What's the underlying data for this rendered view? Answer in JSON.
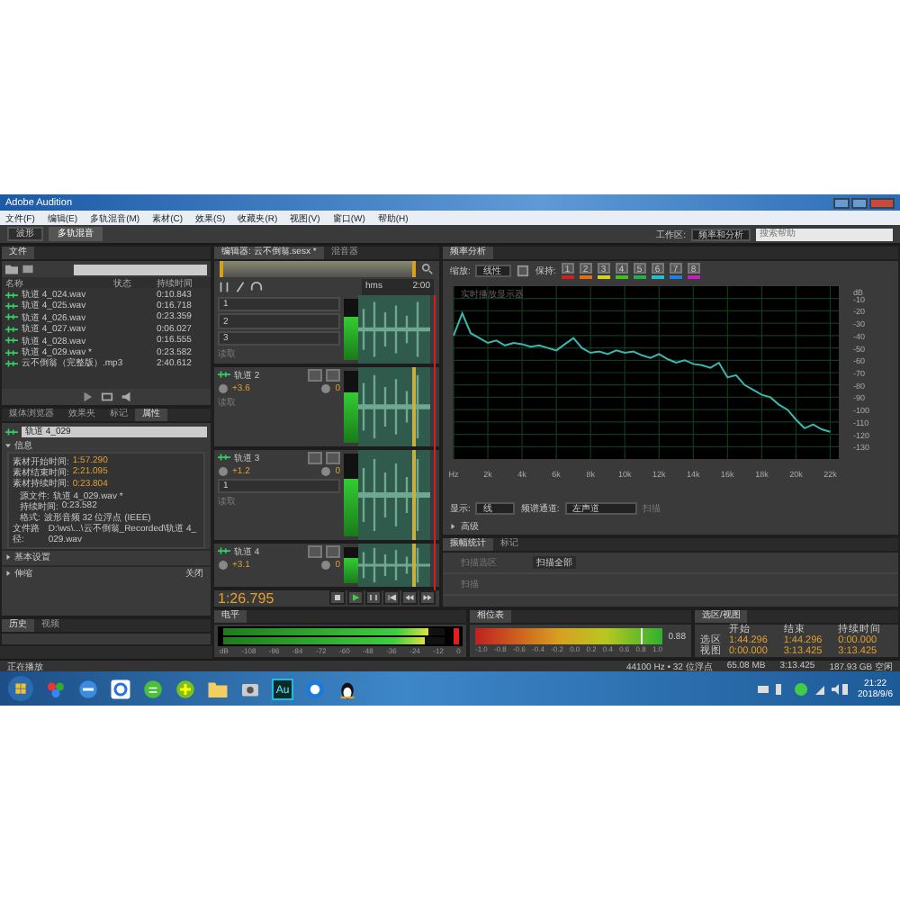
{
  "title_bar": {
    "title": "Adobe Audition"
  },
  "menu": [
    "文件(F)",
    "编辑(E)",
    "多轨混音(M)",
    "素材(C)",
    "效果(S)",
    "收藏夹(R)",
    "视图(V)",
    "窗口(W)",
    "帮助(H)"
  ],
  "toolbar": {
    "modes": [
      {
        "label": "波形",
        "selected": false
      },
      {
        "label": "多轨混音",
        "selected": true
      }
    ],
    "workspace_label": "工作区:",
    "workspace": "频率和分析",
    "search": {
      "placeholder": "搜索帮助"
    }
  },
  "files_panel": {
    "tab": "文件",
    "columns": [
      "名称",
      "状态",
      "持续时间"
    ],
    "rows": [
      {
        "name": "轨道 4_024.wav",
        "duration": "0:10.843"
      },
      {
        "name": "轨道 4_025.wav",
        "duration": "0:16.718"
      },
      {
        "name": "轨道 4_026.wav",
        "duration": "0:23.359"
      },
      {
        "name": "轨道 4_027.wav",
        "duration": "0:06.027"
      },
      {
        "name": "轨道 4_028.wav",
        "duration": "0:16.555"
      },
      {
        "name": "轨道 4_029.wav *",
        "duration": "0:23.582"
      },
      {
        "name": "云不倒翁（完整版）.mp3",
        "duration": "2:40.612"
      }
    ]
  },
  "properties_panel": {
    "tabs": [
      {
        "label": "媒体浏览器",
        "selected": false
      },
      {
        "label": "效果夹",
        "selected": false
      },
      {
        "label": "标记",
        "selected": false
      },
      {
        "label": "属性",
        "selected": true
      }
    ],
    "clip_name": "轨道 4_029",
    "section": "信息",
    "times": [
      {
        "label": "素材开始时间:",
        "value": "1:57.290"
      },
      {
        "label": "素材结束时间:",
        "value": "2:21.095"
      },
      {
        "label": "素材持续时间:",
        "value": "0:23.804"
      }
    ],
    "info": [
      {
        "label": "源文件:",
        "value": "轨道 4_029.wav *"
      },
      {
        "label": "持续时间:",
        "value": "0:23.582"
      },
      {
        "label": "格式:",
        "value": "波形音频 32 位浮点 (IEEE)"
      },
      {
        "label": "文件路径:",
        "value": "D:\\ws\\...\\云不倒翁_Recorded\\轨道 4_029.wav"
      }
    ],
    "groups": [
      {
        "label": "基本设置"
      },
      {
        "label": "伸缩",
        "value": "关闭"
      }
    ]
  },
  "history_panel": {
    "tabs": [
      {
        "label": "历史",
        "selected": true
      },
      {
        "label": "视频",
        "selected": false
      }
    ]
  },
  "editor": {
    "tabs": [
      {
        "label": "编辑器: 云不倒翁.sesx *",
        "selected": true
      },
      {
        "label": "混音器",
        "selected": false
      }
    ],
    "ruler": [
      "hms",
      "2:00"
    ],
    "tracks": [
      {
        "inputs": [
          "1",
          "2",
          "3"
        ],
        "automation": "读取"
      },
      {
        "name": "轨道 2",
        "volume": "+3.6",
        "pan": "0",
        "automation": "读取"
      },
      {
        "name": "轨道 3",
        "volume": "+1.2",
        "pan": "0",
        "inputs": [
          "1"
        ],
        "automation": "读取"
      },
      {
        "name": "轨道 4",
        "volume": "+3.1",
        "pan": "0"
      }
    ],
    "time": "1:26.795"
  },
  "frequency_panel": {
    "tab": "频率分析",
    "scale_label": "缩放:",
    "scale": "线性",
    "hold_label": "保持:",
    "holds": [
      {
        "label": "1",
        "color": "#d02020"
      },
      {
        "label": "2",
        "color": "#e07010"
      },
      {
        "label": "3",
        "color": "#d8d020"
      },
      {
        "label": "4",
        "color": "#40c020"
      },
      {
        "label": "5",
        "color": "#20b050"
      },
      {
        "label": "6",
        "color": "#20c0d0"
      },
      {
        "label": "7",
        "color": "#2080e0"
      },
      {
        "label": "8",
        "color": "#c020c0"
      }
    ],
    "chart_title": "实时播放显示器",
    "chart_data": {
      "type": "line",
      "ylabel": "dB",
      "x": [
        0,
        0.5,
        1,
        1.5,
        2,
        2.5,
        3,
        3.5,
        4,
        4.5,
        5,
        5.5,
        6,
        6.5,
        7,
        7.5,
        8,
        8.5,
        9,
        9.5,
        10,
        10.5,
        11,
        11.5,
        12,
        12.5,
        13,
        13.5,
        14,
        14.5,
        15,
        15.5,
        16,
        16.5,
        17,
        17.5,
        18,
        18.5,
        19,
        19.5,
        20,
        20.5,
        21,
        21.5,
        22
      ],
      "grid": true,
      "series": [
        {
          "color": "#38b8b0",
          "values": [
            -40,
            -22,
            -38,
            -42,
            -46,
            -44,
            -48,
            -46,
            -47,
            -49,
            -48,
            -50,
            -52,
            -47,
            -42,
            -50,
            -54,
            -53,
            -55,
            -52,
            -54,
            -53,
            -56,
            -58,
            -55,
            -59,
            -62,
            -60,
            -63,
            -64,
            -66,
            -62,
            -74,
            -72,
            -80,
            -84,
            -88,
            -90,
            -96,
            -100,
            -108,
            -115,
            -112,
            -116,
            -118
          ]
        }
      ],
      "xlim": [
        0,
        22.5
      ],
      "ylim": [
        -140,
        0
      ],
      "xticks": [
        {
          "value": 0,
          "label": "Hz"
        },
        {
          "value": 2,
          "label": "2k"
        },
        {
          "value": 4,
          "label": "4k"
        },
        {
          "value": 6,
          "label": "6k"
        },
        {
          "value": 8,
          "label": "8k"
        },
        {
          "value": 10,
          "label": "10k"
        },
        {
          "value": 12,
          "label": "12k"
        },
        {
          "value": 14,
          "label": "14k"
        },
        {
          "value": 16,
          "label": "16k"
        },
        {
          "value": 18,
          "label": "18k"
        },
        {
          "value": 20,
          "label": "20k"
        },
        {
          "value": 22,
          "label": "22k"
        }
      ],
      "yticks": [
        -10,
        -20,
        -30,
        -40,
        -50,
        -60,
        -70,
        -80,
        -90,
        -100,
        -110,
        -120,
        -130
      ]
    },
    "display_label": "显示:",
    "display": "线",
    "channel_label": "频谱通道:",
    "channel": "左声道",
    "scan": "扫描",
    "advanced": "高级"
  },
  "amplitude_panel": {
    "tabs": [
      {
        "label": "振幅统计",
        "selected": true
      },
      {
        "label": "标记",
        "selected": false
      }
    ],
    "scan_selection": "扫描选区",
    "scan_all": "扫描全部",
    "scan": "扫描"
  },
  "level_meter": {
    "tab": "电平",
    "channels": [
      {
        "level": 0.93
      },
      {
        "level": 0.91
      }
    ],
    "ticks": [
      "dB",
      "-108",
      "-96",
      "-84",
      "-72",
      "-60",
      "-48",
      "-36",
      "-24",
      "-12",
      "0"
    ]
  },
  "phase_meter": {
    "tab": "相位表",
    "level": 0.88,
    "ticks": [
      "-1.0",
      "-0.8",
      "-0.6",
      "-0.4",
      "-0.2",
      "0.0",
      "0.2",
      "0.4",
      "0.6",
      "0.8",
      "1.0"
    ],
    "reading": "0.88"
  },
  "selection_panel": {
    "tab": "选区/视图",
    "columns": [
      "开始",
      "结束",
      "持续时间"
    ],
    "rows": [
      {
        "label": "选区",
        "values": [
          "1:44.296",
          "1:44.296",
          "0:00.000"
        ]
      },
      {
        "label": "视图",
        "values": [
          "0:00.000",
          "3:13.425",
          "3:13.425"
        ]
      }
    ]
  },
  "status_bar": {
    "left": "正在播放",
    "items": [
      "44100 Hz • 32 位浮点",
      "65.08 MB",
      "3:13.425",
      "187.93 GB 空闲"
    ]
  },
  "taskbar": {
    "app_label": "Au",
    "time": "21:22",
    "date": "2018/9/6"
  }
}
